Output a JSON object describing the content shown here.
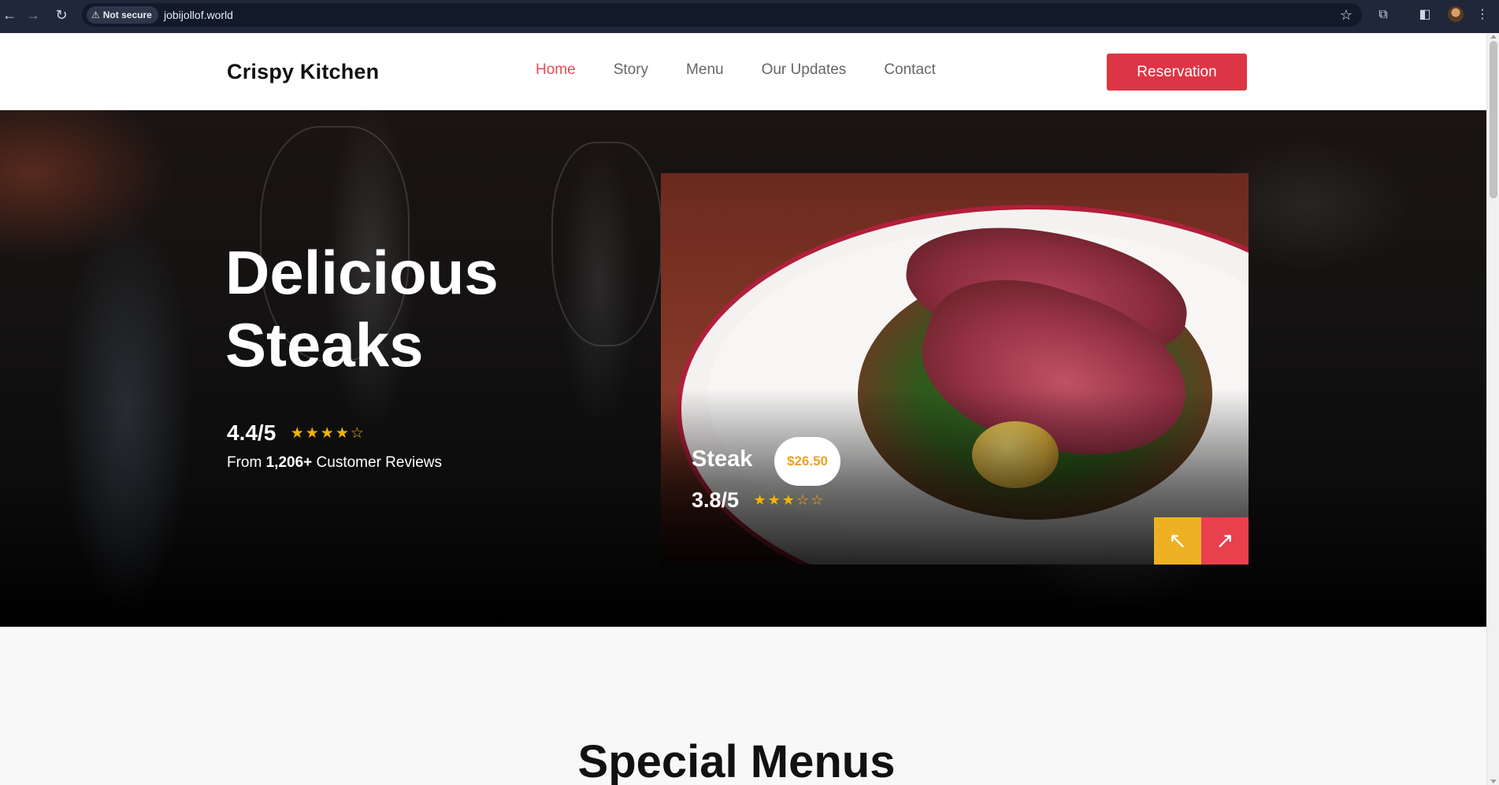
{
  "browser": {
    "security_label": "Not secure",
    "url": "jobijollof.world"
  },
  "header": {
    "brand": "Crispy Kitchen",
    "nav": [
      {
        "label": "Home",
        "active": true
      },
      {
        "label": "Story",
        "active": false
      },
      {
        "label": "Menu",
        "active": false
      },
      {
        "label": "Our Updates",
        "active": false
      },
      {
        "label": "Contact",
        "active": false
      }
    ],
    "reservation_label": "Reservation"
  },
  "hero": {
    "title": "Delicious Steaks",
    "rating": "4.4/5",
    "rating_value": 4.4,
    "stars": "★★★★☆",
    "reviews_prefix": "From ",
    "reviews_count": "1,206+",
    "reviews_suffix": " Customer Reviews"
  },
  "featured_dish": {
    "name": "Steak",
    "price": "$26.50",
    "rating": "3.8/5",
    "rating_value": 3.8,
    "stars": "★★★☆☆",
    "prev_icon": "↖",
    "next_icon": "↗"
  },
  "special_menus": {
    "title": "Special Menus"
  },
  "colors": {
    "accent_red": "#dc3545",
    "nav_active": "#e34b55",
    "star_yellow": "#f4b400",
    "price_yellow": "#e9a41f",
    "prev_button": "#efb124",
    "next_button": "#e8404d"
  }
}
